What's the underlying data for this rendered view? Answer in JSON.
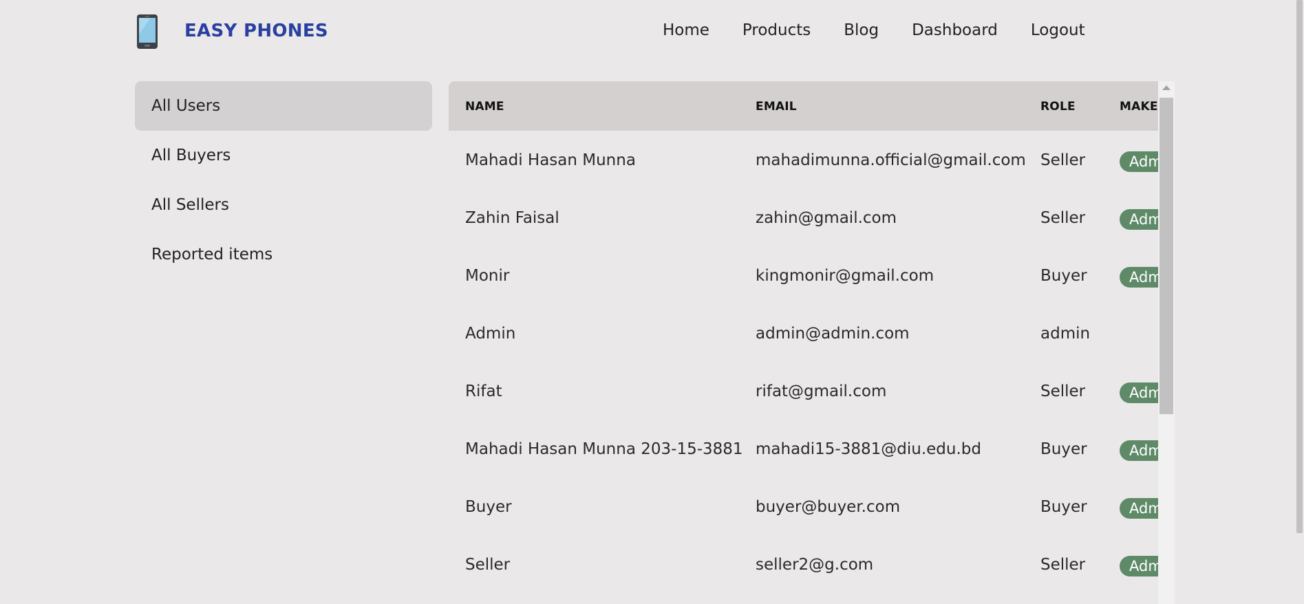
{
  "brand": {
    "name": "EASY PHONES",
    "logo_icon": "phone-icon"
  },
  "nav": [
    "Home",
    "Products",
    "Blog",
    "Dashboard",
    "Logout"
  ],
  "sidebar": {
    "items": [
      {
        "label": "All Users",
        "active": true
      },
      {
        "label": "All Buyers",
        "active": false
      },
      {
        "label": "All Sellers",
        "active": false
      },
      {
        "label": "Reported items",
        "active": false
      }
    ]
  },
  "table": {
    "headers": {
      "name": "NAME",
      "email": "EMAIL",
      "role": "ROLE",
      "make": "MAKE"
    },
    "badge_label": "Admin",
    "rows": [
      {
        "name": "Mahadi Hasan Munna",
        "email": "mahadimunna.official@gmail.com",
        "role": "Seller",
        "has_admin_button": true
      },
      {
        "name": "Zahin Faisal",
        "email": "zahin@gmail.com",
        "role": "Seller",
        "has_admin_button": true
      },
      {
        "name": "Monir",
        "email": "kingmonir@gmail.com",
        "role": "Buyer",
        "has_admin_button": true
      },
      {
        "name": "Admin",
        "email": "admin@admin.com",
        "role": "admin",
        "has_admin_button": false
      },
      {
        "name": "Rifat",
        "email": "rifat@gmail.com",
        "role": "Seller",
        "has_admin_button": true
      },
      {
        "name": "Mahadi Hasan Munna 203-15-3881",
        "email": "mahadi15-3881@diu.edu.bd",
        "role": "Buyer",
        "has_admin_button": true
      },
      {
        "name": "Buyer",
        "email": "buyer@buyer.com",
        "role": "Buyer",
        "has_admin_button": true
      },
      {
        "name": "Seller",
        "email": "seller2@g.com",
        "role": "Seller",
        "has_admin_button": true
      }
    ]
  },
  "colors": {
    "brand": "#2a40a0",
    "badge": "#5e8a68",
    "background": "#eae8e9",
    "active_sidebar": "#d4d1d2",
    "table_header": "#d4d0cf"
  }
}
